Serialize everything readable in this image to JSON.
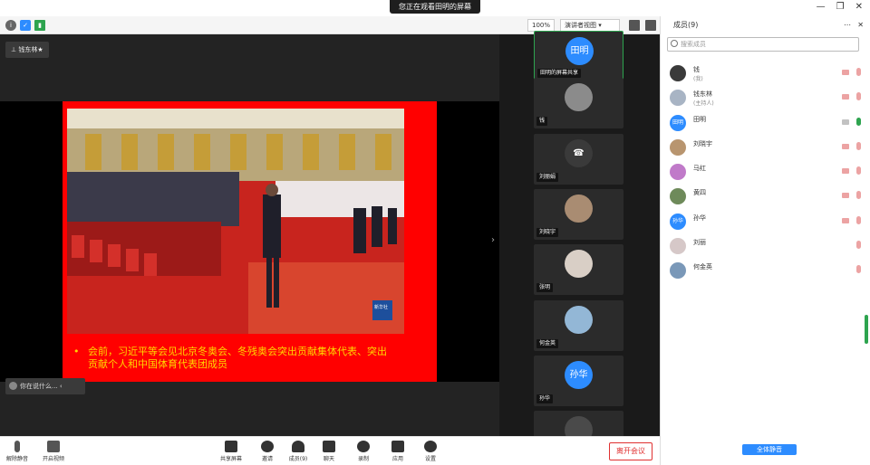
{
  "window": {
    "title": "您正在观看田明的屏幕",
    "controls": [
      "—",
      "❐",
      "✕"
    ]
  },
  "topbar": {
    "zoom": "100%",
    "view_label": "演讲者视图"
  },
  "stage": {
    "speaker_tag": "钱东林★",
    "chat_hint": "你在说什么...",
    "slide": {
      "bullet": "•",
      "caption": "会前，习近平等会见北京冬奥会、冬残奥会突出贡献集体代表、突出贡献个人和中国体育代表团成员",
      "watermark": "新华社"
    }
  },
  "gallery": {
    "tiles": [
      {
        "avatar_text": "田明",
        "name": "田明的屏幕共享"
      },
      {
        "avatar_text": "",
        "name": "钱"
      },
      {
        "avatar_text": "☎",
        "name": "刘丽娟"
      },
      {
        "avatar_text": "",
        "name": "刘晓宇"
      },
      {
        "avatar_text": "",
        "name": "张明"
      },
      {
        "avatar_text": "",
        "name": "何金英"
      },
      {
        "avatar_text": "孙华",
        "name": "孙华"
      },
      {
        "avatar_text": "",
        "name": ""
      }
    ]
  },
  "participants": {
    "header": "成员(9)",
    "search_placeholder": "搜索成员",
    "list": [
      {
        "name": "钱",
        "role": "(我)",
        "avatar": ""
      },
      {
        "name": "钱东林",
        "role": "(主持人)",
        "avatar": ""
      },
      {
        "name": "田明",
        "role": "",
        "avatar": "田明"
      },
      {
        "name": "刘晓宇",
        "role": "",
        "avatar": ""
      },
      {
        "name": "马红",
        "role": "",
        "avatar": ""
      },
      {
        "name": "黄四",
        "role": "",
        "avatar": ""
      },
      {
        "name": "孙华",
        "role": "",
        "avatar": "孙华"
      },
      {
        "name": "刘丽",
        "role": "",
        "avatar": ""
      },
      {
        "name": "何金英",
        "role": "",
        "avatar": ""
      }
    ],
    "mute_all": "全体静音"
  },
  "toolbar": {
    "items": [
      {
        "label": "解除静音"
      },
      {
        "label": "开启视频"
      },
      {
        "label": "共享屏幕"
      },
      {
        "label": "邀请"
      },
      {
        "label": "成员(9)"
      },
      {
        "label": "聊天"
      },
      {
        "label": "录制"
      },
      {
        "label": "应用"
      },
      {
        "label": "设置"
      }
    ],
    "leave": "离开会议"
  },
  "colors": {
    "accent_blue": "#2d8cff",
    "slide_red": "#ff0000",
    "caption_yellow": "#ffd700",
    "active_green": "#2ea44f",
    "leave_red": "#e03030"
  }
}
